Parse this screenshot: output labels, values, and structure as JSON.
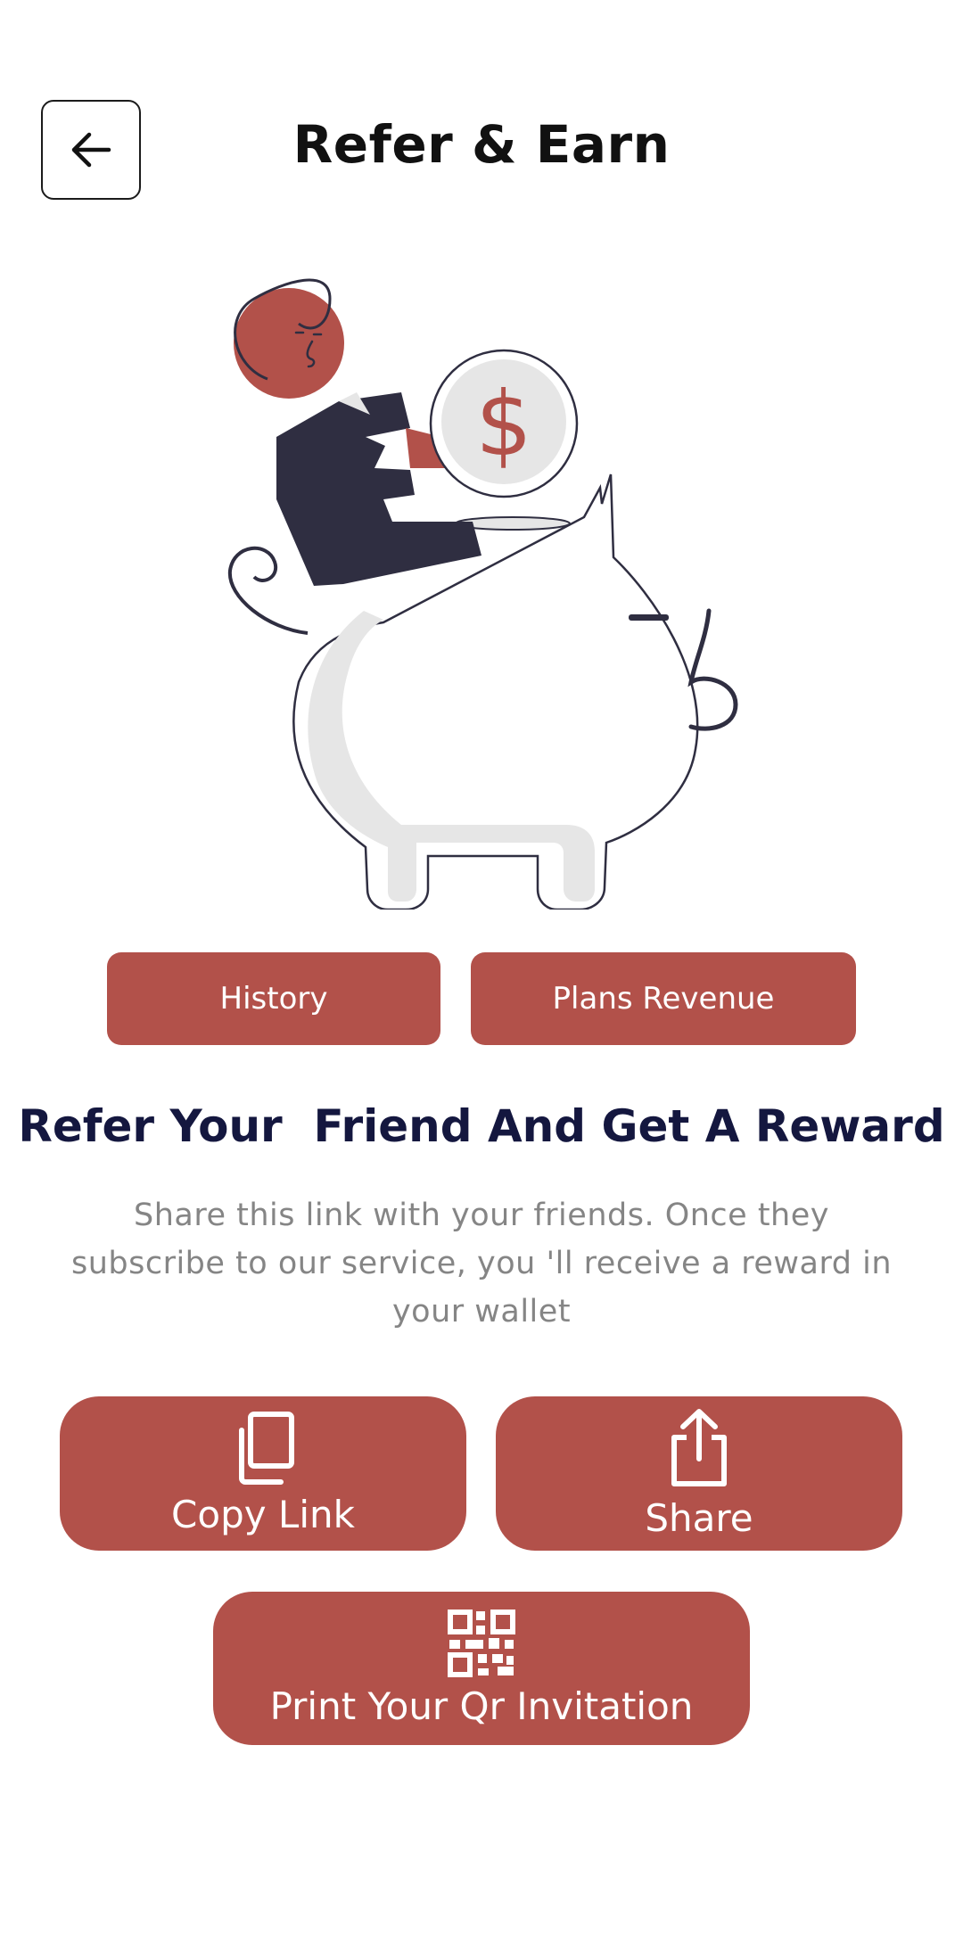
{
  "header": {
    "title": "Refer & Earn",
    "back_icon": "arrow-left-icon"
  },
  "hero": {
    "illustration": "piggy-bank-coin-illustration",
    "coin_symbol": "$"
  },
  "tabs": {
    "history_label": "History",
    "plans_label": "Plans Revenue"
  },
  "content": {
    "headline": "Refer Your  Friend And Get A Reward",
    "description": "Share this link with your friends. Once they subscribe to our service, you 'll receive a reward in your wallet"
  },
  "actions": {
    "copy_label": "Copy Link",
    "copy_icon": "copy-icon",
    "share_label": "Share",
    "share_icon": "share-icon",
    "qr_label": "Print Your Qr Invitation",
    "qr_icon": "qr-code-icon"
  },
  "colors": {
    "accent": "#b2514a",
    "headline": "#14173f",
    "description": "#858585",
    "dark": "#2f2e41",
    "light_gray": "#e6e6e6"
  }
}
